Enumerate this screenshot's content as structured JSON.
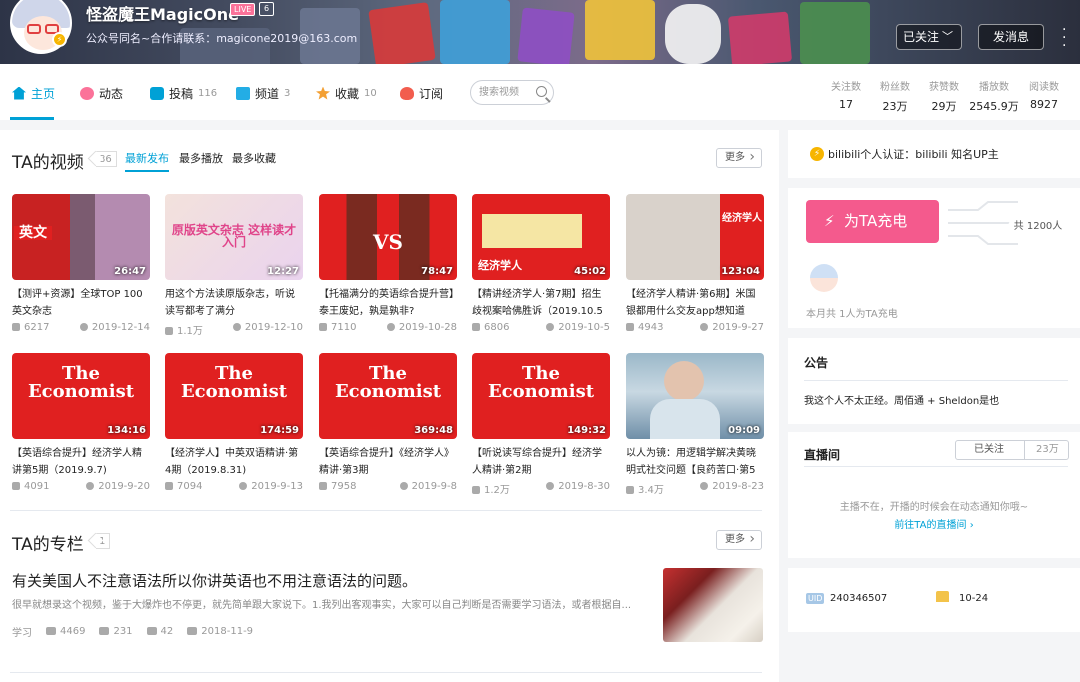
{
  "header": {
    "username": "怪盗魔王MagicOne",
    "live_badge": "LIVE",
    "level_badge": "6",
    "sign": "公众号同名~合作请联系：magicone2019@163.com",
    "follow_label": "已关注",
    "message_label": "发消息"
  },
  "nav": {
    "tabs": [
      {
        "label": "主页",
        "count": ""
      },
      {
        "label": "动态",
        "count": ""
      },
      {
        "label": "投稿",
        "count": "116"
      },
      {
        "label": "频道",
        "count": "3"
      },
      {
        "label": "收藏",
        "count": "10"
      },
      {
        "label": "订阅",
        "count": ""
      }
    ],
    "search_placeholder": "搜索视频",
    "stats": [
      {
        "label": "关注数",
        "value": "17"
      },
      {
        "label": "粉丝数",
        "value": "23万"
      },
      {
        "label": "获赞数",
        "value": "29万"
      },
      {
        "label": "播放数",
        "value": "2545.9万"
      },
      {
        "label": "阅读数",
        "value": "8927"
      }
    ]
  },
  "videos": {
    "title": "TA的视频",
    "count": "86",
    "sorts": [
      "最新发布",
      "最多播放",
      "最多收藏"
    ],
    "more": "更多",
    "items": [
      {
        "thumb_text": "英文",
        "duration": "26:47",
        "title": "【测评+资源】全球TOP 100英文杂志",
        "plays": "6217",
        "date": "2019-12-14"
      },
      {
        "thumb_text": "原版英文杂志 这样读才入门",
        "duration": "12:27",
        "title": "用这个方法读原版杂志，听说读写都考了满分",
        "plays": "1.1万",
        "date": "2019-12-10"
      },
      {
        "thumb_text": "VS",
        "duration": "78:47",
        "title": "【托福满分的英语综合提升营】泰王废妃，孰是孰非?",
        "plays": "7110",
        "date": "2019-10-28"
      },
      {
        "thumb_text": "经济学人",
        "duration": "45:02",
        "title": "【精讲经济学人·第7期】招生歧视案哈佛胜诉（2019.10.5",
        "plays": "6806",
        "date": "2019-10-5"
      },
      {
        "thumb_text": "经济学人",
        "duration": "123:04",
        "title": "【经济学人精讲·第6期】米国银都用什么交友app想知道",
        "plays": "4943",
        "date": "2019-9-27"
      },
      {
        "thumb_text": "The Economist",
        "duration": "134:16",
        "title": "【英语综合提升】经济学人精讲第5期（2019.9.7)",
        "plays": "4091",
        "date": "2019-9-20"
      },
      {
        "thumb_text": "The Economist",
        "duration": "174:59",
        "title": "【经济学人】中英双语精讲·第4期（2019.8.31)",
        "plays": "7094",
        "date": "2019-9-13"
      },
      {
        "thumb_text": "The Economist",
        "duration": "369:48",
        "title": "【英语综合提升】《经济学人》精讲·第3期",
        "plays": "7958",
        "date": "2019-9-8"
      },
      {
        "thumb_text": "The Economist",
        "duration": "149:32",
        "title": "【听说读写综合提升】经济学人精讲·第2期",
        "plays": "1.2万",
        "date": "2019-8-30"
      },
      {
        "thumb_text": "",
        "duration": "09:09",
        "title": "以人为镜：用逻辑学解决黄晓明式社交问题【良药苦口·第5",
        "plays": "3.4万",
        "date": "2019-8-23"
      }
    ]
  },
  "column": {
    "title": "TA的专栏",
    "count": "1",
    "more": "更多",
    "article_title": "有关美国人不注意语法所以你讲英语也不用注意语法的问题。",
    "article_desc": "很早就想录这个视频，鉴于大爆炸也不停更，就先简单跟大家说下。1.我列出客观事实，大家可以自己判断是否需要学习语法，或者根据自...",
    "category": "学习",
    "views": "4469",
    "likes": "231",
    "comments": "42",
    "date": "2018-11-9"
  },
  "sidebar": {
    "cert": "bilibili个人认证：bilibili 知名UP主",
    "charge_btn": "为TA充电",
    "charge_total": "共 1200人",
    "charge_month": "本月共 1人为TA充电",
    "notice_title": "公告",
    "notice_text": "我这个人不太正经。周佰通 + Sheldon是也",
    "live_title": "直播间",
    "live_follow": "已关注",
    "live_fans": "23万",
    "live_off": "主播不在，开播的时候会在动态通知你哦~",
    "live_link": "前往TA的直播间",
    "uid_label": "UID",
    "uid": "240346507",
    "birthday": "10-24"
  },
  "colors": {
    "accent": "#00a1d6",
    "pink": "#fb7299",
    "thumb_red": "#e02020"
  }
}
